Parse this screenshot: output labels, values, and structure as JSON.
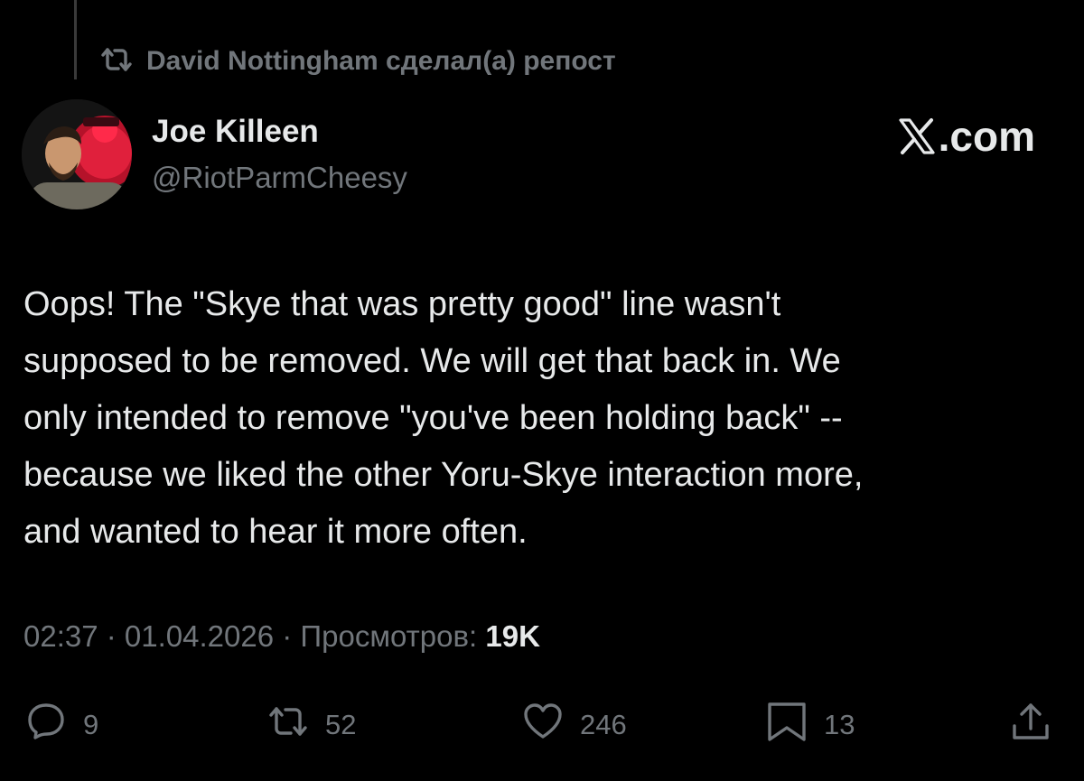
{
  "repost": {
    "label": "David Nottingham сделал(а) репост",
    "icon": "repost-icon"
  },
  "author": {
    "display_name": "Joe Killeen",
    "handle": "@RiotParmCheesy",
    "avatar": "avatar"
  },
  "watermark": {
    "text": ".com",
    "icon": "x-logo-icon"
  },
  "tweet": {
    "lines": [
      "Oops! The \"Skye that was pretty good\" line wasn't",
      "supposed to be removed. We will get that back in.  We",
      "only intended to remove \"you've been holding back\" --",
      "because we liked the other Yoru-Skye interaction more,",
      "and wanted to hear it more often."
    ]
  },
  "meta": {
    "time": "02:37",
    "separator": " · ",
    "date": "01.04.2026",
    "views_label": "Просмотров:",
    "views_count": "19K"
  },
  "actions": {
    "replies": {
      "count": "9",
      "icon": "reply-icon"
    },
    "reposts": {
      "count": "52",
      "icon": "repost-icon"
    },
    "likes": {
      "count": "246",
      "icon": "heart-icon"
    },
    "bookmarks": {
      "count": "13",
      "icon": "bookmark-icon"
    },
    "share": {
      "icon": "share-icon"
    }
  },
  "colors": {
    "background": "#000000",
    "primary_text": "#e7e9ea",
    "secondary_text": "#71767b"
  }
}
